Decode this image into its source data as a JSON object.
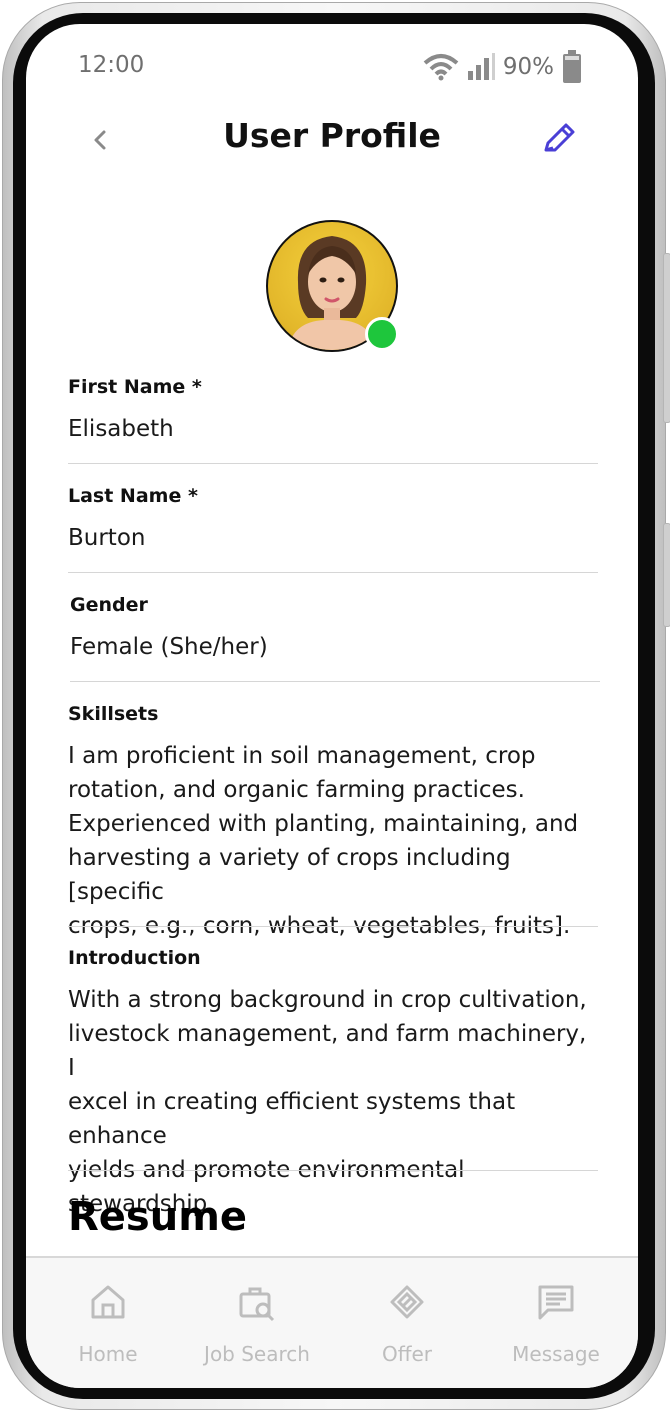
{
  "status": {
    "time": "12:00",
    "battery": "90%"
  },
  "header": {
    "title": "User Profile",
    "back_icon": "chevron-left-icon",
    "edit_icon": "pencil-icon"
  },
  "colors": {
    "accent": "#4a3fd6",
    "online": "#1ec63c",
    "nav_inactive": "#bdbdbd"
  },
  "profile": {
    "first_name": {
      "label": "First Name *",
      "value": "Elisabeth"
    },
    "last_name": {
      "label": "Last Name *",
      "value": "Burton"
    },
    "gender": {
      "label": "Gender",
      "value": "Female (She/her)"
    },
    "skillsets": {
      "label": "Skillsets",
      "lines": [
        "I am proficient in soil management, crop",
        "rotation, and organic farming practices.",
        "Experienced with planting, maintaining, and",
        "harvesting a variety of crops including [specific",
        "crops, e.g., corn, wheat, vegetables, fruits]."
      ]
    },
    "introduction": {
      "label": "Introduction",
      "lines": [
        "With a strong background in crop cultivation,",
        "livestock management, and farm machinery, I",
        "excel in creating efficient systems that enhance",
        "yields and promote environmental",
        "stewardship."
      ]
    }
  },
  "resume": {
    "heading": "Resume"
  },
  "nav": {
    "items": [
      {
        "label": "Home",
        "icon": "home-icon"
      },
      {
        "label": "Job Search",
        "icon": "job-search-icon"
      },
      {
        "label": "Offer",
        "icon": "handshake-icon"
      },
      {
        "label": "Message",
        "icon": "message-icon"
      }
    ]
  }
}
